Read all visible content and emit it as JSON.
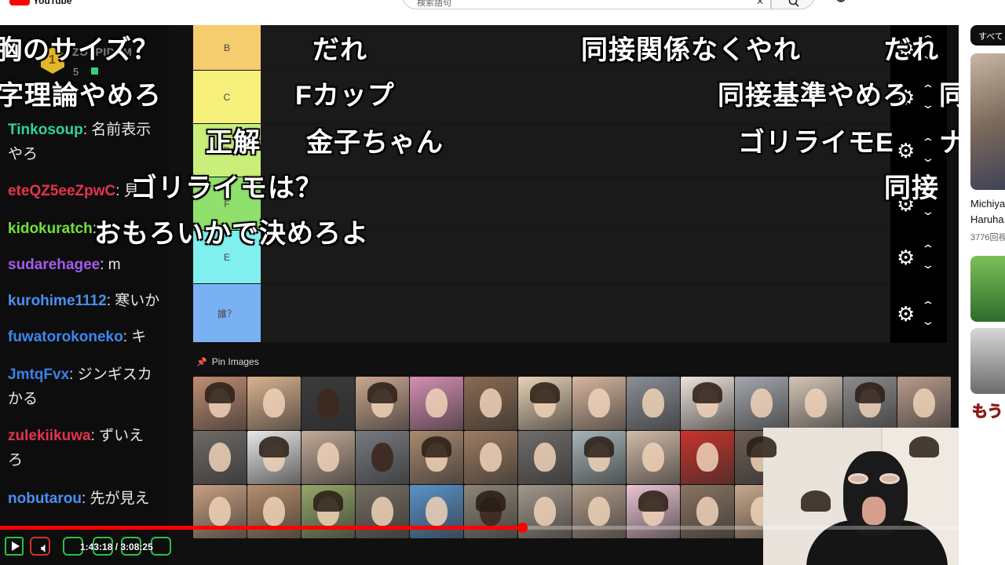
{
  "header": {
    "logo_text": "YouTube",
    "search_placeholder": "検索語句"
  },
  "chat": {
    "banner": {
      "name": "ZOLPIDEM",
      "badge_num": "1",
      "level": "5"
    },
    "messages": [
      {
        "user": "Tinkosoup",
        "text": "名前表示",
        "text2": "やろ",
        "color": "#2ed3a0"
      },
      {
        "user": "eteQZ5eeZpwC",
        "text": "見",
        "color": "#e5334d"
      },
      {
        "user": "kidokuratch",
        "text": "",
        "color": "#6ee03d"
      },
      {
        "user": "sudarehagee",
        "text": "m",
        "color": "#a45bf0"
      },
      {
        "user": "kurohime1112",
        "text": "寒いか",
        "color": "#4a8ff2"
      },
      {
        "user": "fuwatorokoneko",
        "text": "キ",
        "color": "#3d86f0"
      },
      {
        "user": "JmtqFvx",
        "text": "ジンギスカ",
        "text2": "かる",
        "color": "#3d7fe8"
      },
      {
        "user": "zulekiikuwa",
        "text": "ずいえ",
        "text2": "ろ",
        "color": "#e5334d"
      },
      {
        "user": "nobutarou",
        "text": "先が見え",
        "color": "#4a8ff2"
      }
    ]
  },
  "tiers": [
    {
      "label": "B",
      "color": "#f5cc6e"
    },
    {
      "label": "C",
      "color": "#f7f07a"
    },
    {
      "label": "D",
      "color": "#c9ee7a"
    },
    {
      "label": "F",
      "color": "#8fe06c"
    },
    {
      "label": "E",
      "color": "#7ff0ee"
    },
    {
      "label": "誰？",
      "color": "#79b1f2"
    }
  ],
  "pin_images_label": "Pin Images",
  "face_colors": [
    "#c08d72",
    "#d9b38f",
    "#3b3b3b",
    "#caa68f",
    "#d58fb2",
    "#8b6b52",
    "#e7d2b5",
    "#d8b79e",
    "#8a8f96",
    "#ede4da",
    "#a3a7ac",
    "#d4c6b7",
    "#8c8c8c",
    "#b89c8b",
    "#6f6a66",
    "#e8e8e8",
    "#c2aa98",
    "#777a80",
    "#a88a6f",
    "#9e7d62",
    "#706d6b",
    "#a7b4b8",
    "#d1bba8",
    "#c8342d",
    "#6e5e55",
    "#bcc0c4",
    "#d9c3b1",
    "#555555",
    "#c79f83",
    "#b58d6d",
    "#95a76a",
    "#756d63",
    "#5a93c9",
    "#8d8577",
    "#a2988b",
    "#b09c89",
    "#ecc4d3",
    "#8a7461",
    "#c9a88d",
    "#6b5c50",
    "#9b8c7e",
    "#b2a395"
  ],
  "danmaku": [
    {
      "text": "胸のサイズ？"
    },
    {
      "text": "だれ"
    },
    {
      "text": "同接関係なくやれ"
    },
    {
      "text": "だれ"
    },
    {
      "text": "字理論やめろ"
    },
    {
      "text": "Fカップ"
    },
    {
      "text": "同接基準やめろ"
    },
    {
      "text": "同"
    },
    {
      "text": "正解"
    },
    {
      "text": "金子ちゃん"
    },
    {
      "text": "ゴリライモE"
    },
    {
      "text": "ナ"
    },
    {
      "text": "ゴリライモは？"
    },
    {
      "text": "同接"
    },
    {
      "text": "おもろいかで決めろよ"
    }
  ],
  "player": {
    "time_current": "1:43:18",
    "time_total": "3:08:25",
    "progress": 0.545
  },
  "sidebar": {
    "chip": "すべて",
    "video1_title": "Michiya",
    "video1_subtitle": "Haruha",
    "video1_meta": "3776回視",
    "video3_overlay": "もう"
  }
}
